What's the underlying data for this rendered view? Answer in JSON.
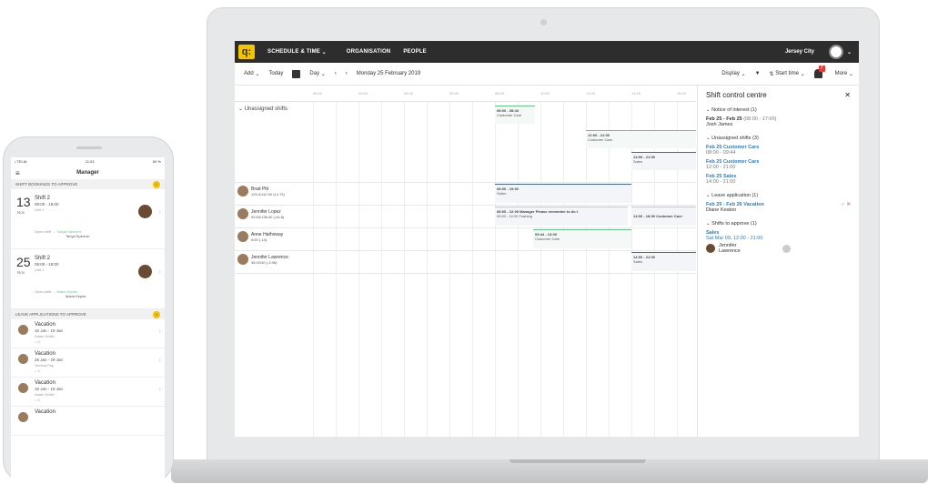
{
  "laptop": {
    "nav": {
      "logo": "q:",
      "items": [
        "SCHEDULE & TIME",
        "ORGANISATION",
        "PEOPLE"
      ],
      "location": "Jersey City"
    },
    "toolbar": {
      "add": "Add",
      "today": "Today",
      "view": "Day",
      "date": "Monday 25 February 2019",
      "display": "Display",
      "sort": "Start time",
      "notifications": "7",
      "more": "More"
    },
    "times": [
      "06:00",
      "03:00",
      "04:00",
      "05:00",
      "08:00",
      "10:00",
      "12:00",
      "14:00",
      "16:00"
    ],
    "unassigned_label": "Unassigned shifts",
    "employees": [
      {
        "name": "Brad Pitt",
        "hours": "125.4/110.00 (14.73)"
      },
      {
        "name": "Jennifer Lopez",
        "hours": "93.60/138.40 (-44.8)"
      },
      {
        "name": "Anne Hathoway",
        "hours": "0/20 (-14)"
      },
      {
        "name": "Jennifer Lawrence",
        "hours": "36.02/40 (-3.98)"
      }
    ],
    "shifts": [
      {
        "time": "08:00 - 08:44",
        "label": "Customer Care"
      },
      {
        "time": "12:00 - 21:00",
        "label": "Customer Care"
      },
      {
        "time": "14:00 - 21:00",
        "label": "Sales"
      },
      {
        "time": "08:00 - 19:00",
        "label": "Sales"
      },
      {
        "time": "08:00 - 22:00 Manager  Please remember to do t",
        "label": "09:00 - 12:00 Training"
      },
      {
        "time": "14:00 - 18:00 Customer Care",
        "label": ""
      },
      {
        "time": "09:44 - 14:00",
        "label": "Customer Care"
      },
      {
        "time": "14:00 - 21:00",
        "label": "Sales"
      }
    ],
    "panel": {
      "title": "Shift control centre",
      "notice": "Notice of interest (1)",
      "notice_line": "Feb 25 - Feb 25",
      "notice_time": "(08:00 - 17:00)",
      "notice_name": "Josh James",
      "unassigned": "Unassigned shifts (3)",
      "u1": "Feb 25 Customer Care",
      "u1t": "08:00 - 09:44",
      "u2": "Feb 25 Customer Care",
      "u2t": "12:00 - 21:00",
      "u3": "Feb 25 Sales",
      "u3t": "14:00 - 21:00",
      "leave": "Leave application (1)",
      "leave_line": "Feb 25 - Feb 26 Vacation",
      "leave_name": "Diane Keaton",
      "approve": "Shifts to approve (1)",
      "a_label": "Sales",
      "a_time": "Sat Mar 09, 12:00 - 21:00",
      "a_name1": "Jennifer",
      "a_name2": "Lawrence"
    }
  },
  "phone": {
    "carrier": "ᵢₗ TELIA",
    "clock": "11:03",
    "battery": "60 %",
    "title": "Manager",
    "sec1": "SHIFT BOOKINGS TO APPROVE",
    "sec1_count": "2",
    "items": [
      {
        "day": "13",
        "mon": "Nov",
        "title": "Shift 2",
        "time": "09:00 - 18:00",
        "unit": "Unit 1",
        "to": "Tanya Spencer",
        "name": "Tanya Spencer"
      },
      {
        "day": "25",
        "mon": "Nov",
        "title": "Shift 2",
        "time": "09:00 - 18:00",
        "unit": "Unit 1",
        "to": "Maria Kepler",
        "name": "Maria Kepler"
      }
    ],
    "open_label": "Open shift",
    "sec2": "LEAVE APPLICATIONS TO APPROVE",
    "sec2_count": "3",
    "leaves": [
      {
        "title": "Vacation",
        "date": "16 Jan - 19 Jan",
        "name": "Adam Smith",
        "count": "4"
      },
      {
        "title": "Vacation",
        "date": "26 Jan - 29 Jan",
        "name": "Jemma Fay",
        "count": "4"
      },
      {
        "title": "Vacation",
        "date": "16 Jan - 19 Jan",
        "name": "Adam Smith",
        "count": "4"
      },
      {
        "title": "Vacation",
        "date": "",
        "name": "",
        "count": ""
      }
    ]
  }
}
